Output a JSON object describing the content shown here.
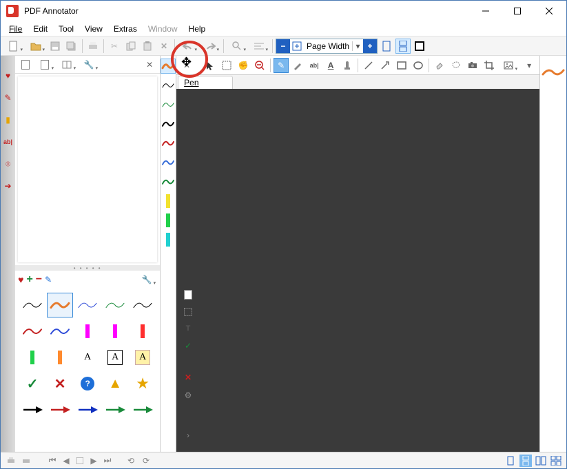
{
  "app": {
    "title": "PDF Annotator"
  },
  "menu": {
    "file": "File",
    "edit": "Edit",
    "tool": "Tool",
    "view": "View",
    "extras": "Extras",
    "window": "Window",
    "help": "Help"
  },
  "toolbar1": {
    "new": "new-doc",
    "open": "open",
    "save": "save",
    "save_all": "save-all",
    "print": "print",
    "cut": "cut",
    "copy": "copy",
    "paste": "paste",
    "delete": "delete",
    "undo": "undo",
    "redo": "redo",
    "find": "find",
    "align": "align",
    "zoom": {
      "label": "Page Width"
    },
    "fit_page": "fit-page",
    "fit_width": "fit-width",
    "two_page": "two-page"
  },
  "doc_toolbar": {
    "tools": [
      "pan",
      "select",
      "hand",
      "zoom-out"
    ],
    "ann_tools": [
      "pen",
      "marker",
      "text-box",
      "text",
      "stamp"
    ],
    "shapes": [
      "line",
      "arrow",
      "rect",
      "ellipse"
    ],
    "extras": [
      "eraser",
      "lasso",
      "camera",
      "crop",
      "image"
    ]
  },
  "current_tool": "pen",
  "tab": {
    "label": "Pen"
  },
  "left_rail": {
    "items": [
      "bookmark-icon",
      "note-icon",
      "page-icon",
      "attachment-icon"
    ]
  },
  "side_icons": [
    "heart",
    "pen-red",
    "page",
    "text-ab",
    "stamp",
    "arrow-red"
  ],
  "fav_toolbar": {
    "add": "+",
    "remove": "−",
    "edit": "edit",
    "settings": "settings"
  },
  "presets": [
    {
      "type": "wave",
      "color": "#e67b2e",
      "thick": 3,
      "selected": true
    },
    {
      "type": "wave",
      "color": "#000000",
      "thick": 1
    },
    {
      "type": "wave",
      "color": "#198a3a",
      "thick": 1
    },
    {
      "type": "wave",
      "color": "#000000",
      "thick": 2
    },
    {
      "type": "wave",
      "color": "#c32020",
      "thick": 2
    },
    {
      "type": "wave",
      "color": "#3a6fd8",
      "thick": 2
    },
    {
      "type": "wave",
      "color": "#198a3a",
      "thick": 2
    },
    {
      "type": "bar",
      "color": "#f2e22e"
    },
    {
      "type": "bar",
      "color": "#20d04a"
    },
    {
      "type": "bar",
      "color": "#20d0d0"
    }
  ],
  "favorites": [
    {
      "type": "wave",
      "color": "#000",
      "thick": 1
    },
    {
      "type": "wave",
      "color": "#e67b2e",
      "thick": 3,
      "selected": true
    },
    {
      "type": "wave",
      "color": "#2e4bd8",
      "thick": 1
    },
    {
      "type": "wave",
      "color": "#198a3a",
      "thick": 1
    },
    {
      "type": "wave",
      "color": "#000",
      "thick": 1
    },
    {
      "type": "wave",
      "color": "#c32020",
      "thick": 2
    },
    {
      "type": "wave",
      "color": "#2e4bd8",
      "thick": 2
    },
    {
      "type": "bar",
      "color": "#ff00ff"
    },
    {
      "type": "bar",
      "color": "#ff00ff"
    },
    {
      "type": "bar",
      "color": "#ff2e2e"
    },
    {
      "type": "bar",
      "color": "#20d04a"
    },
    {
      "type": "bar",
      "color": "#ff8a2e"
    },
    {
      "type": "textA",
      "bg": "none",
      "label": "A"
    },
    {
      "type": "textA",
      "bg": "#fff",
      "border": "#000",
      "label": "A"
    },
    {
      "type": "textA",
      "bg": "#fff2a8",
      "border": "#caa",
      "label": "A"
    },
    {
      "type": "check",
      "color": "#198a3a"
    },
    {
      "type": "cross",
      "color": "#c32020"
    },
    {
      "type": "qmark",
      "color": "#1e6fd8"
    },
    {
      "type": "warn",
      "color": "#e6a500"
    },
    {
      "type": "star",
      "color": "#e6a500"
    },
    {
      "type": "arrow",
      "color": "#000"
    },
    {
      "type": "arrow",
      "color": "#c32020"
    },
    {
      "type": "arrow",
      "color": "#1030c0"
    },
    {
      "type": "arrow",
      "color": "#198a3a"
    },
    {
      "type": "arrow",
      "color": "#198a3a"
    }
  ],
  "misc_rail": [
    "doc",
    "box",
    "text-t",
    "check",
    "x-red",
    "gear"
  ],
  "statusbar": {
    "nav": [
      "print",
      "print2",
      "first",
      "prev",
      "stop",
      "next",
      "last",
      "back",
      "fwd"
    ],
    "views": [
      "single",
      "continuous",
      "two-up",
      "two-cont"
    ],
    "active_view": 1
  }
}
